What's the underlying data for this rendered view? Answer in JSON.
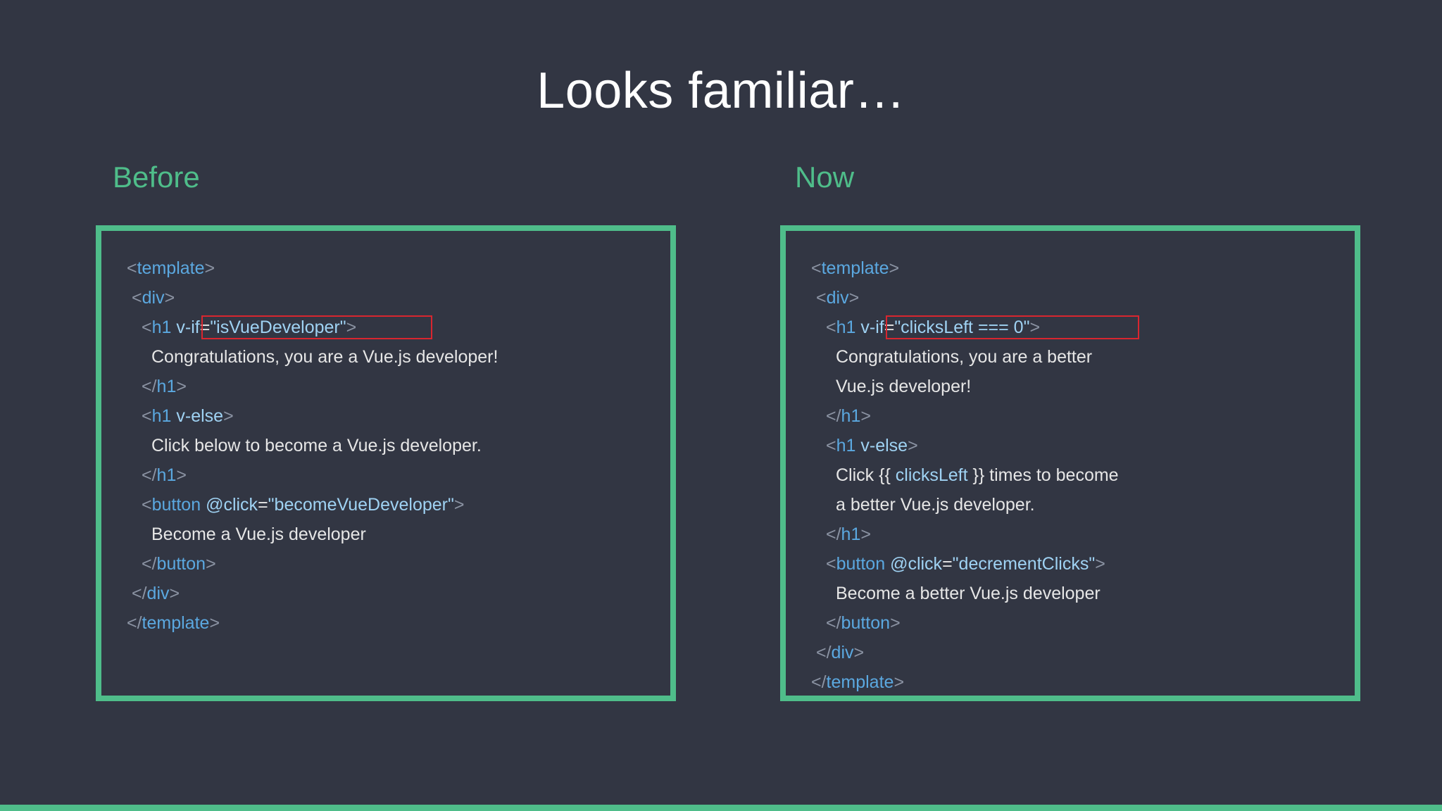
{
  "slide": {
    "title": "Looks familiar…"
  },
  "columns": {
    "left_heading": "Before",
    "right_heading": "Now"
  },
  "before_code": {
    "l1": {
      "open": "<",
      "tag": "template",
      "close": ">"
    },
    "l2": {
      "open": "<",
      "tag": "div",
      "close": ">"
    },
    "l3": {
      "open": "<",
      "tag": "h1",
      "attr": " v-if",
      "eq": "=",
      "str": "\"isVueDeveloper\"",
      "close": ">"
    },
    "l4": "Congratulations, you are a Vue.js developer!",
    "l5": {
      "open": "</",
      "tag": "h1",
      "close": ">"
    },
    "l6": {
      "open": "<",
      "tag": "h1",
      "attr": " v-else",
      "close": ">"
    },
    "l7": "Click below to become a Vue.js developer.",
    "l8": {
      "open": "</",
      "tag": "h1",
      "close": ">"
    },
    "l9": {
      "open": "<",
      "tag": "button",
      "attr": " @click",
      "eq": "=",
      "str": "\"becomeVueDeveloper\"",
      "close": ">"
    },
    "l10": "Become a Vue.js developer",
    "l11": {
      "open": "</",
      "tag": "button",
      "close": ">"
    },
    "l12": {
      "open": "</",
      "tag": "div",
      "close": ">"
    },
    "l13": {
      "open": "</",
      "tag": "template",
      "close": ">"
    }
  },
  "now_code": {
    "l1": {
      "open": "<",
      "tag": "template",
      "close": ">"
    },
    "l2": {
      "open": "<",
      "tag": "div",
      "close": ">"
    },
    "l3": {
      "open": "<",
      "tag": "h1",
      "attr": " v-if",
      "eq": "=",
      "str": "\"clicksLeft === 0\"",
      "close": ">"
    },
    "l4": "Congratulations, you are a better",
    "l5": "Vue.js developer!",
    "l6": {
      "open": "</",
      "tag": "h1",
      "close": ">"
    },
    "l7": {
      "open": "<",
      "tag": "h1",
      "attr": " v-else",
      "close": ">"
    },
    "l8": {
      "pre": "Click {{ ",
      "var": "clicksLeft",
      "post": " }} times to become"
    },
    "l9": "a better Vue.js developer.",
    "l10": {
      "open": "</",
      "tag": "h1",
      "close": ">"
    },
    "l11": {
      "open": "<",
      "tag": "button",
      "attr": " @click",
      "eq": "=",
      "str": "\"decrementClicks\"",
      "close": ">"
    },
    "l12": "Become a better Vue.js developer",
    "l13": {
      "open": "</",
      "tag": "button",
      "close": ">"
    },
    "l14": {
      "open": "</",
      "tag": "div",
      "close": ">"
    },
    "l15": {
      "open": "</",
      "tag": "template",
      "close": ">"
    }
  },
  "colors": {
    "background": "#323643",
    "accent_green": "#4fbd8a",
    "highlight_red": "#d8262f",
    "tag_blue": "#5ba8e0"
  }
}
